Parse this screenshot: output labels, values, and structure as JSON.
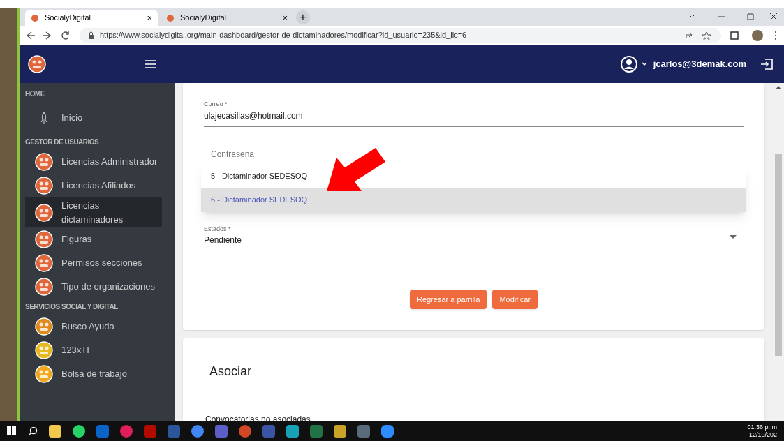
{
  "browser": {
    "tabs": [
      {
        "title": "SocialyDigital",
        "selected": true,
        "close": "×"
      },
      {
        "title": "SocialyDigital",
        "selected": false,
        "close": "×"
      }
    ],
    "new_tab": "+",
    "url": "https://www.socialydigital.org/main-dashboard/gestor-de-dictaminadores/modificar?id_usuario=235&id_lic=6"
  },
  "header": {
    "user": "jcarlos@3demak.com"
  },
  "sidebar": {
    "sections": [
      {
        "title": "HOME",
        "items": [
          {
            "label": "Inicio",
            "kind": "rocket",
            "selected": false
          }
        ]
      },
      {
        "title": "GESTOR DE USUARIOS",
        "items": [
          {
            "label": "Licencias Administrador",
            "kind": "logo",
            "selected": false
          },
          {
            "label": "Licencias Afiliados",
            "kind": "logo",
            "selected": false
          },
          {
            "label": "Licencias dictaminadores",
            "kind": "logo",
            "selected": true
          },
          {
            "label": "Figuras",
            "kind": "logo",
            "selected": false
          },
          {
            "label": "Permisos secciones",
            "kind": "logo",
            "selected": false
          },
          {
            "label": "Tipo de organizaciones",
            "kind": "logo",
            "selected": false
          }
        ]
      },
      {
        "title": "SERVICIOS SOCIAL Y DIGITAL",
        "items": [
          {
            "label": "Busco Ayuda",
            "kind": "busco",
            "selected": false
          },
          {
            "label": "123xTI",
            "kind": "xti",
            "selected": false
          },
          {
            "label": "Bolsa de trabajo",
            "kind": "bolsa",
            "selected": false
          }
        ]
      }
    ]
  },
  "form": {
    "email": {
      "label": "Correo *",
      "value": "ulajecasillas@hotmail.com"
    },
    "password": {
      "label": "Contraseña"
    },
    "dropdown_options": [
      {
        "label": "5 - Dictaminador SEDESOQ",
        "selected": false
      },
      {
        "label": "6 - Dictaminador SEDESOQ",
        "selected": true
      }
    ],
    "estado": {
      "label": "Estados *",
      "value": "Pendiente"
    },
    "buttons": [
      "Regresar a parrilla",
      "Modificar"
    ]
  },
  "asociar": {
    "title": "Asociar",
    "subtitle": "Convocatorias no asociadas"
  },
  "taskbar": {
    "apps": [
      {
        "kind": "explorer",
        "color": "#f2c94c"
      },
      {
        "kind": "whatsapp",
        "color": "#25d366"
      },
      {
        "kind": "outlook",
        "color": "#0a64c8"
      },
      {
        "kind": "slack",
        "color": "#e01e5a"
      },
      {
        "kind": "acrobat",
        "color": "#b30b00"
      },
      {
        "kind": "word",
        "color": "#2b579a"
      },
      {
        "kind": "chrome",
        "color": "#4285f4"
      },
      {
        "kind": "teams",
        "color": "#5b5fc7"
      },
      {
        "kind": "powerpoint",
        "color": "#d24726"
      },
      {
        "kind": "visio",
        "color": "#3955a3"
      },
      {
        "kind": "k",
        "color": "#17a2b8"
      },
      {
        "kind": "excel",
        "color": "#217346"
      },
      {
        "kind": "notes",
        "color": "#c9a227"
      },
      {
        "kind": "calculator",
        "color": "#5a6b7b"
      },
      {
        "kind": "zoom",
        "color": "#2d8cff"
      }
    ],
    "time": "01:36 p. m",
    "date": "12/10/202"
  }
}
